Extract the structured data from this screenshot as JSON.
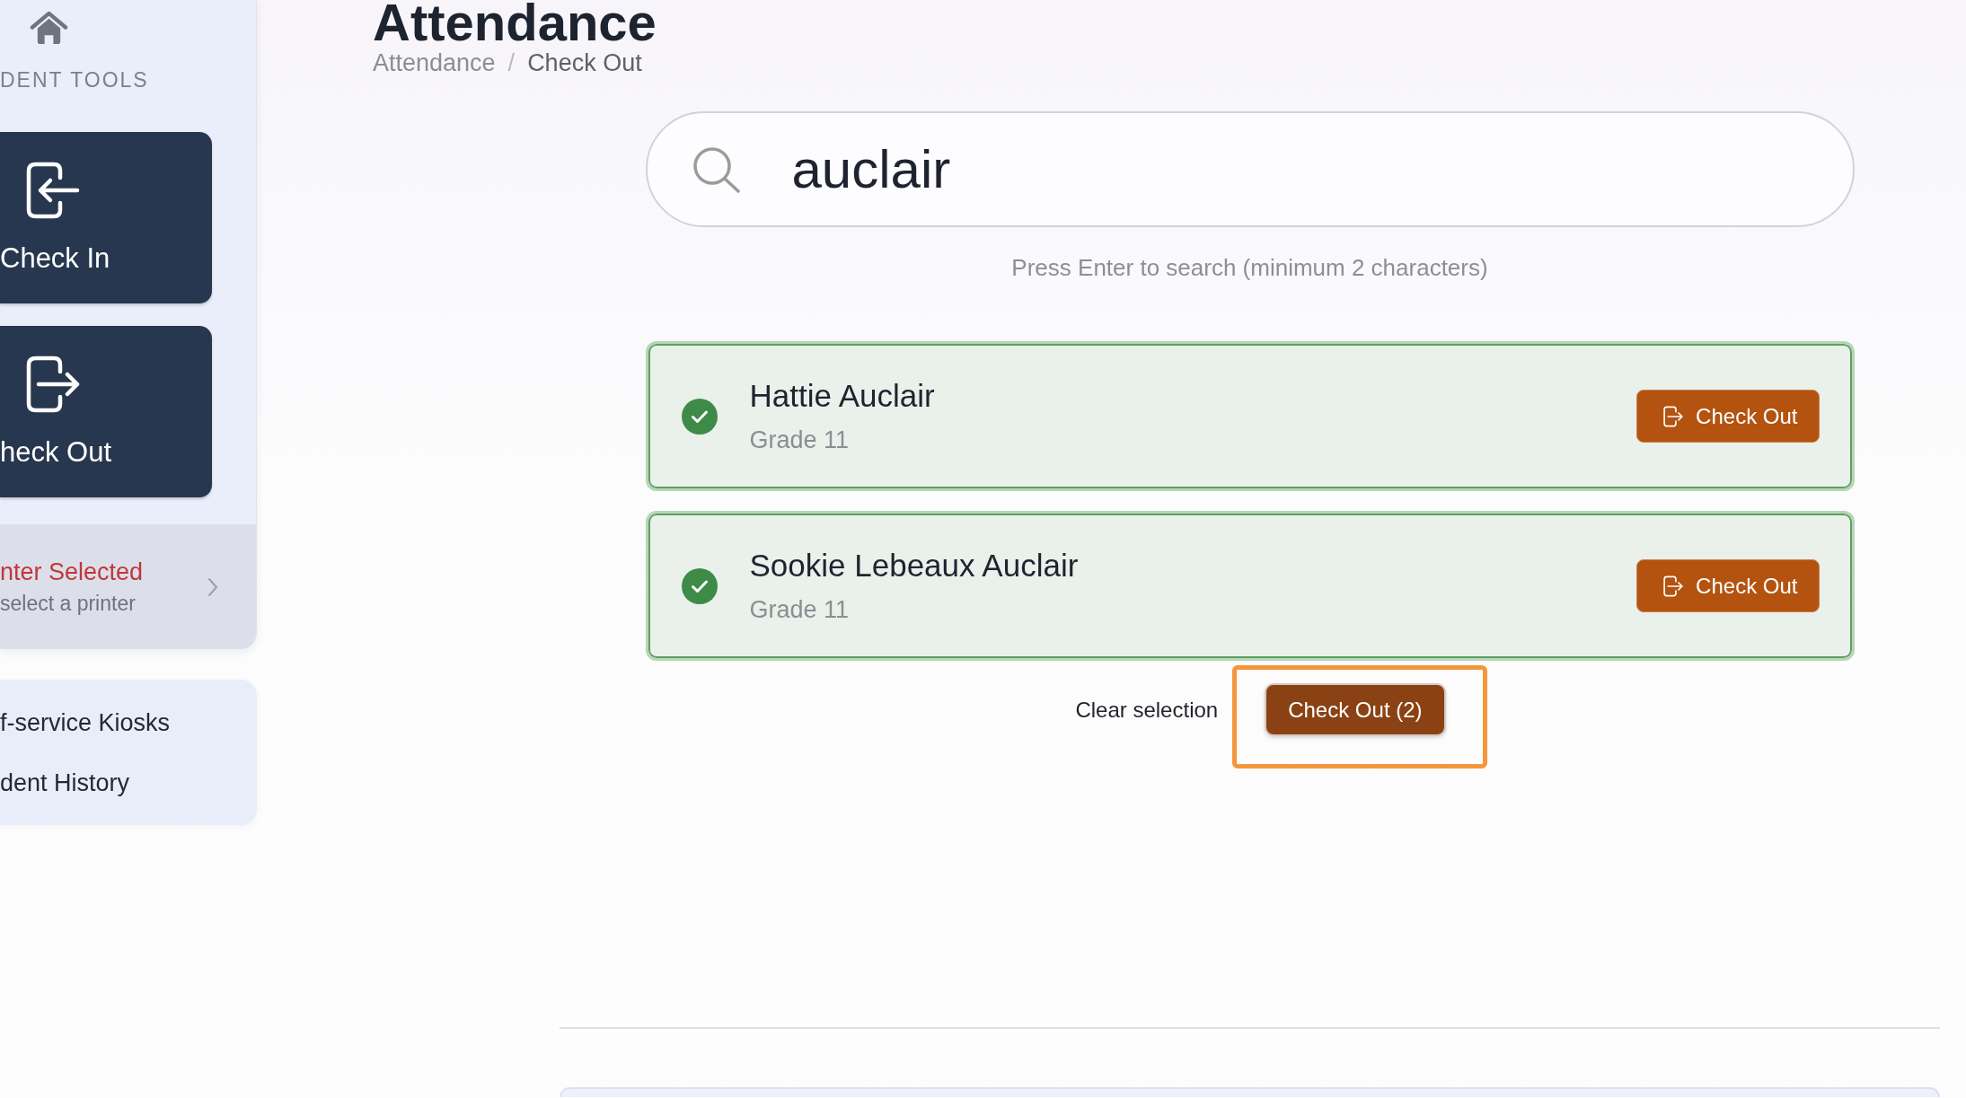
{
  "sidebar": {
    "section_title": "DENT TOOLS",
    "tools": [
      {
        "kind": "check-in",
        "label": "Check In"
      },
      {
        "kind": "check-out",
        "label": "heck Out"
      }
    ],
    "printer": {
      "title": "nter Selected",
      "subtitle": "select a printer",
      "warning": true
    },
    "links": [
      {
        "label": "f-service Kiosks"
      },
      {
        "label": "dent History"
      }
    ]
  },
  "page": {
    "title": "Attendance",
    "breadcrumb": {
      "separator": "/",
      "items": [
        {
          "label": "Attendance",
          "current": false
        },
        {
          "label": "Check Out",
          "current": true
        }
      ]
    }
  },
  "search": {
    "value": "auclair",
    "hint": "Press Enter to search (minimum 2 characters)"
  },
  "results": [
    {
      "name": "Hattie Auclair",
      "detail": "Grade 11",
      "selected": true,
      "action": "Check Out"
    },
    {
      "name": "Sookie Lebeaux Auclair",
      "detail": "Grade 11",
      "selected": true,
      "action": "Check Out"
    }
  ],
  "bulk": {
    "clear_label": "Clear selection",
    "action_label": "Check Out (2)",
    "highlighted": true
  }
}
